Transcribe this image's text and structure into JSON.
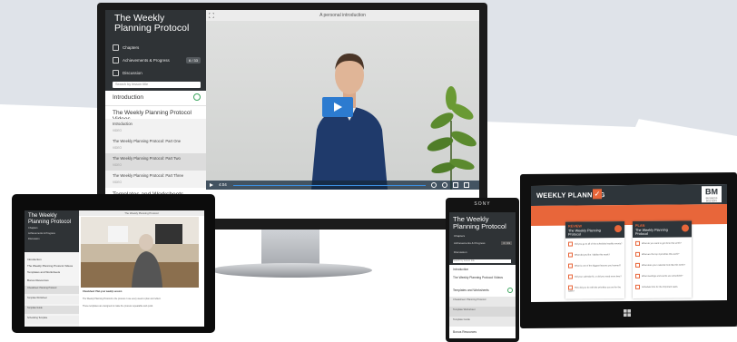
{
  "desktop": {
    "course_title": "The Weekly Planning Protocol",
    "nav": [
      {
        "label": "Chapters",
        "icon": "list-icon"
      },
      {
        "label": "Achievements & Progress",
        "icon": "trophy-icon",
        "badge": "6 / 33"
      },
      {
        "label": "Discussion",
        "icon": "chat-icon"
      }
    ],
    "search_placeholder": "Search by lesson title",
    "sections": {
      "intro": "Introduction",
      "videos": "The Weekly Planning Protocol Videos",
      "templates": "Templates and Worksheets"
    },
    "lessons": [
      {
        "title": "Introduction",
        "meta": "VIDEO"
      },
      {
        "title": "The Weekly Planning Protocol: Part One",
        "meta": "VIDEO"
      },
      {
        "title": "The Weekly Planning Protocol: Part Two",
        "meta": "VIDEO"
      },
      {
        "title": "The Weekly Planning Protocol: Part Three",
        "meta": "VIDEO"
      }
    ],
    "video_title": "A personal introduction",
    "time": "4:04"
  },
  "tablet_left": {
    "title": "The Weekly Planning Protocol",
    "nav": [
      "Chapters",
      "Achievements & Progress",
      "Discussion"
    ],
    "sections": [
      "Introduction",
      "The Weekly Planning Protocol Videos",
      "Templates and Worksheets",
      "Bonus Resources"
    ],
    "items": [
      "Cheatsheet: Planning Protocol",
      "Template Worksheet",
      "Template Guide",
      "Scheduling Template"
    ],
    "header": "The Weekly Planning Protocol",
    "caption": "Cheatsheet: Plan your weekly session",
    "body1": "The Weekly Planning Protocol is the process I use every week to plan and reflect.",
    "body2": "These templates are designed to make the process repeatable and quick."
  },
  "phone": {
    "brand": "SONY",
    "title": "The Weekly Planning Protocol",
    "nav": [
      {
        "label": "Chapters"
      },
      {
        "label": "Achievements & Progress",
        "badge": "6 / 33"
      },
      {
        "label": "Discussion"
      }
    ],
    "search_placeholder": "Search by lesson title",
    "sections": [
      "Introduction",
      "The Weekly Planning Protocol Videos",
      "Templates and Worksheets",
      "Bonus Resources"
    ],
    "items": [
      "Cheatsheet: Planning Protocol",
      "Template Worksheet",
      "Template Guide"
    ]
  },
  "tablet_right": {
    "logo": "WEEKLY PLANNING",
    "brand": "BM",
    "brand_sub": "BUSINESS MASTERY",
    "cards": [
      {
        "kicker": "REVIEW",
        "title": "The Weekly Planning Protocol",
        "items": [
          "Did you go to all of the scheduled weekly events?",
          "What did you like / dislike this week?",
          "What is one of the biggest lessons you learned?",
          "Did your calendar fit, or did you need more time?",
          "How did you do with the priorities you set for the week?"
        ]
      },
      {
        "kicker": "PLAN",
        "title": "The Weekly Planning Protocol",
        "items": [
          "What do you want to get done this week?",
          "What are the top 3 priorities this week?",
          "What does your calendar look like this week?",
          "What meetings and events are scheduled?",
          "Schedule time for the important tasks."
        ]
      }
    ]
  },
  "colors": {
    "sidebar": "#2f3336",
    "accent": "#2c7bd0",
    "orange": "#e8663a",
    "green": "#3ba55d"
  }
}
